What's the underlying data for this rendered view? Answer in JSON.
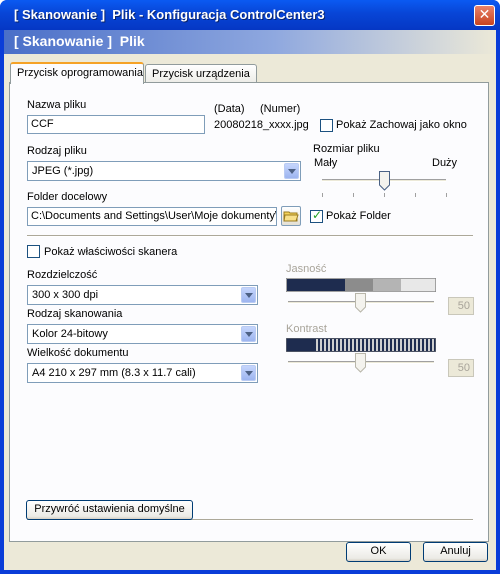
{
  "window": {
    "title": "[ Skanowanie ]  Plik - Konfiguracja ControlCenter3",
    "close_glyph": "✕"
  },
  "header": {
    "title": "[ Skanowanie ]  Plik"
  },
  "tabs": [
    {
      "label": "Przycisk oprogramowania",
      "active": true
    },
    {
      "label": "Przycisk urządzenia",
      "active": false
    }
  ],
  "file_name": {
    "label": "Nazwa pliku",
    "value": "CCF",
    "data_label": "(Data)",
    "number_label": "(Numer)",
    "example": "20080218_xxxx.jpg"
  },
  "show_save_as": {
    "label": "Pokaż Zachowaj jako okno",
    "checked": false
  },
  "file_type": {
    "label": "Rodzaj pliku",
    "value": "JPEG (*.jpg)"
  },
  "file_size": {
    "label": "Rozmiar pliku",
    "min_label": "Mały",
    "max_label": "Duży",
    "level": 0.5
  },
  "destination": {
    "label": "Folder docelowy",
    "value": "C:\\Documents and Settings\\User\\Moje dokumenty\\M",
    "show_folder_label": "Pokaż Folder",
    "show_folder_checked": true
  },
  "show_scanner_props": {
    "label": "Pokaż właściwości skanera",
    "checked": false
  },
  "resolution": {
    "label": "Rozdzielczość",
    "value": "300 x 300 dpi"
  },
  "scan_type": {
    "label": "Rodzaj skanowania",
    "value": "Kolor 24-bitowy"
  },
  "doc_size": {
    "label": "Wielkość dokumentu",
    "value": "A4 210 x 297 mm (8.3 x 11.7 cali)"
  },
  "brightness": {
    "label": "Jasność",
    "value": "50",
    "level": 0.5,
    "enabled": false
  },
  "contrast": {
    "label": "Kontrast",
    "value": "50",
    "level": 0.5,
    "enabled": false
  },
  "restore_defaults": {
    "label": "Przywróć ustawienia domyślne"
  },
  "ok": {
    "label": "OK"
  },
  "cancel": {
    "label": "Anuluj"
  },
  "colors": {
    "titlebar": "#0a3dd8",
    "dialog": "#ece9d8",
    "accent": "#f5a226"
  }
}
